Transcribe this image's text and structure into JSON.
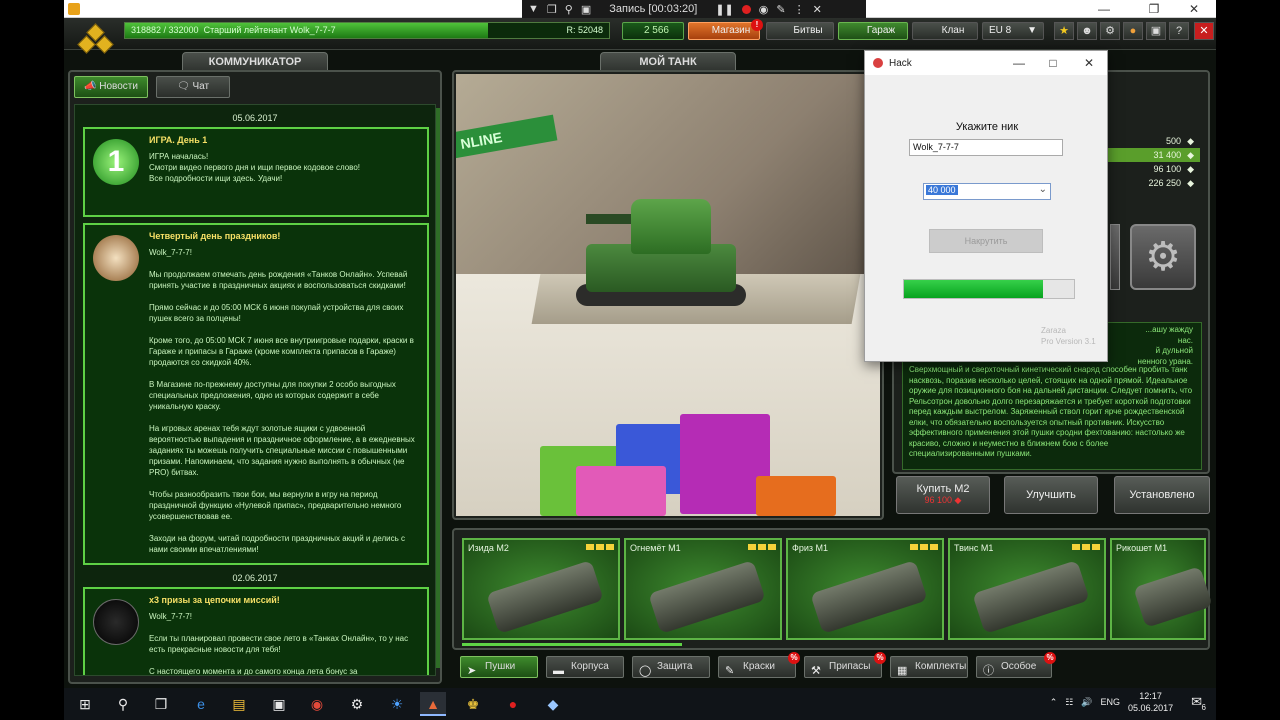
{
  "recorder": {
    "label": "Запись [00:03:20]"
  },
  "hud": {
    "xp_text": "318882 / 332000",
    "rank_name": "Старший лейтенант Wolk_7-7-7",
    "rating": "R: 52048",
    "crystals": "2 566",
    "shop": "Магазин",
    "battles": "Битвы",
    "garage": "Гараж",
    "clan": "Клан",
    "server": "EU 8",
    "shop_badge": "!",
    "help": "?",
    "close": "✕"
  },
  "tabs": {
    "communicator": "КОММУНИКАТОР",
    "my_tank": "МОЙ ТАНК",
    "news": "Новости",
    "chat": "Чат"
  },
  "news": {
    "date1": "05.06.2017",
    "item1_title": "ИГРА. День 1",
    "item1_body": "ИГРА началась!\nСмотри видео первого дня и ищи первое кодовое слово!\nВсе подробности ищи здесь. Удачи!",
    "item2_title": "Четвертый день праздников!",
    "item2_body": "Wolk_7-7-7!\n\nМы продолжаем отмечать день рождения «Танков Онлайн». Успевай принять участие в праздничных акциях и воспользоваться скидками!\n\nПрямо сейчас и до 05:00 МСК 6 июня покупай устройства для своих пушек всего за полцены!\n\nКроме того, до 05:00 МСК 7 июня все внутриигровые подарки, краски в Гараже и припасы в Гараже (кроме комплекта припасов в Гараже) продаются со скидкой 40%.\n\nВ Магазине по-прежнему доступны для покупки 2 особо выгодных специальных предложения, одно из которых содержит в себе уникальную краску.\n\nНа игровых аренах тебя ждут золотые ящики с удвоенной вероятностью выпадения и праздничное оформление, а в ежедневных заданиях ты можешь получить специальные миссии с повышенными призами. Напоминаем, что задания нужно выполнять в обычных (не PRO) битвах.\n\nЧтобы разнообразить твои бои, мы вернули в игру на период праздничной функцию «Нулевой припас», предварительно немного усовершенствовав ее.\n\nЗаходи на форум, читай подробности праздничных акций и делись с нами своими впечатлениями!",
    "date2": "02.06.2017",
    "item3_title": "х3 призы за цепочки миссий!",
    "item3_body": "Wolk_7-7-7!\n\nЕсли ты планировал провести свое лето в «Танках Онлайн», то у нас есть прекрасные новости для тебя!\n\nС настоящего момента и до самого конца лета бонус за"
  },
  "viewer": {
    "banner": "NLINE"
  },
  "garage": {
    "stats": [
      {
        "value": "500",
        "highlight": false
      },
      {
        "value": "31 400",
        "highlight": true
      },
      {
        "value": "96 100",
        "highlight": false
      },
      {
        "value": "226 250",
        "highlight": false
      }
    ],
    "description": "Сверхмощный и сверхточный кинетический снаряд способен пробить танк насквозь, поразив несколько целей, стоящих на одной прямой. Идеальное оружие для позиционного боя на дальней дистанции. Следует помнить, что Рельсотрон довольно долго перезаряжается и требует короткой подготовки перед каждым выстрелом. Заряженный ствол горит ярче рождественской елки, что обязательно воспользуется опытный противник. Искусство эффективного применения этой пушки сродни фехтованию: настолько же красиво, сложно и неуместно в ближнем бою с более специализированными пушками.",
    "desc_partial_1": "...ашу жажду",
    "desc_partial_2": "нас.",
    "desc_partial_3": "й дульной",
    "desc_partial_4": "ненного урана.",
    "buy_label": "Купить М2",
    "buy_price": "96 100",
    "upgrade_label": "Улучшить",
    "installed_label": "Установлено"
  },
  "items": [
    {
      "name": "Изида М2"
    },
    {
      "name": "Огнемёт М1"
    },
    {
      "name": "Фриз М1"
    },
    {
      "name": "Твинс М1"
    },
    {
      "name": "Рикошет М1"
    }
  ],
  "categories": [
    {
      "label": "Пушки",
      "badge": ""
    },
    {
      "label": "Корпуса",
      "badge": ""
    },
    {
      "label": "Защита",
      "badge": ""
    },
    {
      "label": "Краски",
      "badge": "%"
    },
    {
      "label": "Припасы",
      "badge": "%"
    },
    {
      "label": "Комплекты",
      "badge": ""
    },
    {
      "label": "Особое",
      "badge": "%"
    }
  ],
  "dialog": {
    "title": "Hack",
    "prompt": "Укажите ник",
    "nick_value": "Wolk_7-7-7",
    "amount_value": "40 000",
    "button": "Накрутить",
    "progress": 0.82,
    "author": "Zaraza",
    "version": "Pro Version 3.1"
  },
  "taskbar": {
    "lang": "ENG",
    "time": "12:17",
    "date": "05.06.2017",
    "notif_count": "6"
  }
}
